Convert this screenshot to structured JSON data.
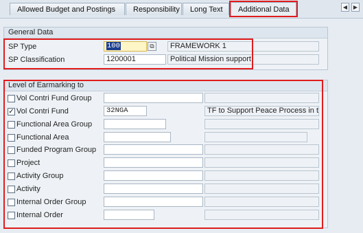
{
  "tabs": [
    {
      "label": "Allowed Budget and Postings"
    },
    {
      "label": "Responsibility"
    },
    {
      "label": "Long Text"
    },
    {
      "label": "Additional Data"
    }
  ],
  "nav": {
    "left_icon": "triangle-left-icon",
    "right_icon": "triangle-right-icon"
  },
  "general": {
    "title": "General Data",
    "sp_type": {
      "label": "SP Type",
      "value": "100",
      "description": "FRAMEWORK 1"
    },
    "sp_classification": {
      "label": "SP Classification",
      "value": "1200001",
      "description": "Political Mission support"
    }
  },
  "earmarking": {
    "title": "Level of Earmarking to",
    "rows": [
      {
        "label": "Vol Contri Fund Group",
        "checked": false,
        "value": "",
        "description": ""
      },
      {
        "label": "Vol Contri Fund",
        "checked": true,
        "value": "32NGA",
        "description": "TF to Support Peace Process in th..."
      },
      {
        "label": "Functional Area Group",
        "checked": false,
        "value": "",
        "description": ""
      },
      {
        "label": "Functional Area",
        "checked": false,
        "value": "",
        "description": ""
      },
      {
        "label": "Funded Program Group",
        "checked": false,
        "value": "",
        "description": ""
      },
      {
        "label": "Project",
        "checked": false,
        "value": "",
        "description": ""
      },
      {
        "label": "Activity Group",
        "checked": false,
        "value": "",
        "description": ""
      },
      {
        "label": "Activity",
        "checked": false,
        "value": "",
        "description": ""
      },
      {
        "label": "Internal Order Group",
        "checked": false,
        "value": "",
        "description": ""
      },
      {
        "label": "Internal Order",
        "checked": false,
        "value": "",
        "description": ""
      }
    ]
  },
  "colors": {
    "highlight": "#e11b1b",
    "selection": "#1d3f8f"
  }
}
